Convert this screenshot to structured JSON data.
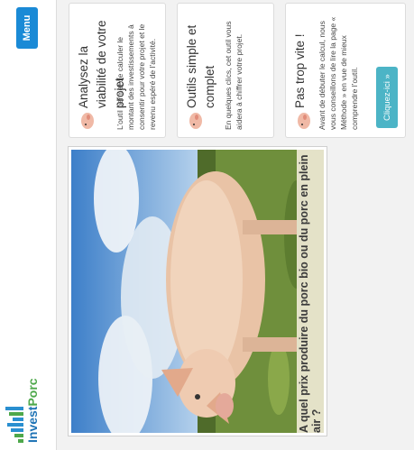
{
  "header": {
    "logo_prefix": "Invest",
    "logo_suffix": "Porc",
    "menu_label": "Menu"
  },
  "hero": {
    "caption": "A quel prix produire du porc bio ou du porc en plein air ?"
  },
  "cards": [
    {
      "title": "Analysez la viabilité de votre projet",
      "body": "L’outil permet de calculer le montant des investissements à consentir pour votre projet et le revenu espéré de l’activité.",
      "icon": "pig-icon"
    },
    {
      "title": "Outils simple et complet",
      "body": "En quelques clics, cet outil vous aidera à chiffrer votre projet.",
      "icon": "pig-icon"
    },
    {
      "title": "Pas trop vite !",
      "body": "Avant de débuter le calcul, nous vous conseillons de lire la page « Méthode » en vue de mieux comprendre l’outil.",
      "cta_label": "Cliquez-ici »",
      "icon": "pig-icon"
    }
  ],
  "colors": {
    "menu": "#1a8ad6",
    "cta": "#4cb4c6",
    "logo_blue": "#1e73b5",
    "logo_green": "#4ea84b"
  }
}
